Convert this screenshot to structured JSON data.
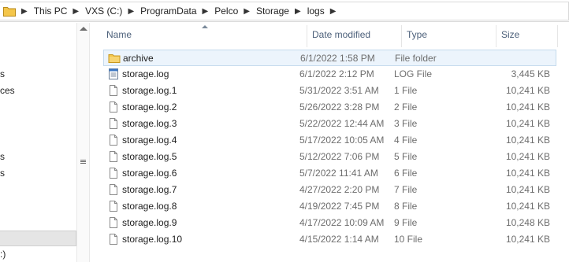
{
  "address": {
    "crumbs": [
      "This PC",
      "VXS (C:)",
      "ProgramData",
      "Pelco",
      "Storage",
      "logs"
    ]
  },
  "nav": {
    "fragments": [
      "s",
      "ces",
      "s",
      "s",
      ":)"
    ]
  },
  "columns": {
    "name": "Name",
    "date": "Date modified",
    "type": "Type",
    "size": "Size"
  },
  "files": [
    {
      "name": "archive",
      "date": "6/1/2022 1:58 PM",
      "type": "File folder",
      "size": "",
      "icon": "folder-icon",
      "selected": true
    },
    {
      "name": "storage.log",
      "date": "6/1/2022 2:12 PM",
      "type": "LOG File",
      "size": "3,445 KB",
      "icon": "log-file-icon"
    },
    {
      "name": "storage.log.1",
      "date": "5/31/2022 3:51 AM",
      "type": "1 File",
      "size": "10,241 KB",
      "icon": "file-icon"
    },
    {
      "name": "storage.log.2",
      "date": "5/26/2022 3:28 PM",
      "type": "2 File",
      "size": "10,241 KB",
      "icon": "file-icon"
    },
    {
      "name": "storage.log.3",
      "date": "5/22/2022 12:44 AM",
      "type": "3 File",
      "size": "10,241 KB",
      "icon": "file-icon"
    },
    {
      "name": "storage.log.4",
      "date": "5/17/2022 10:05 AM",
      "type": "4 File",
      "size": "10,241 KB",
      "icon": "file-icon"
    },
    {
      "name": "storage.log.5",
      "date": "5/12/2022 7:06 PM",
      "type": "5 File",
      "size": "10,241 KB",
      "icon": "file-icon"
    },
    {
      "name": "storage.log.6",
      "date": "5/7/2022 11:41 AM",
      "type": "6 File",
      "size": "10,241 KB",
      "icon": "file-icon"
    },
    {
      "name": "storage.log.7",
      "date": "4/27/2022 2:20 PM",
      "type": "7 File",
      "size": "10,241 KB",
      "icon": "file-icon"
    },
    {
      "name": "storage.log.8",
      "date": "4/19/2022 7:45 PM",
      "type": "8 File",
      "size": "10,241 KB",
      "icon": "file-icon"
    },
    {
      "name": "storage.log.9",
      "date": "4/17/2022 10:09 AM",
      "type": "9 File",
      "size": "10,248 KB",
      "icon": "file-icon"
    },
    {
      "name": "storage.log.10",
      "date": "4/15/2022 1:14 AM",
      "type": "10 File",
      "size": "10,241 KB",
      "icon": "file-icon"
    }
  ],
  "colors": {
    "header_text": "#4c607a",
    "selection_bg": "#ecf4fc",
    "selection_border": "#c5daed",
    "folder_yellow": "#f4c64a"
  }
}
